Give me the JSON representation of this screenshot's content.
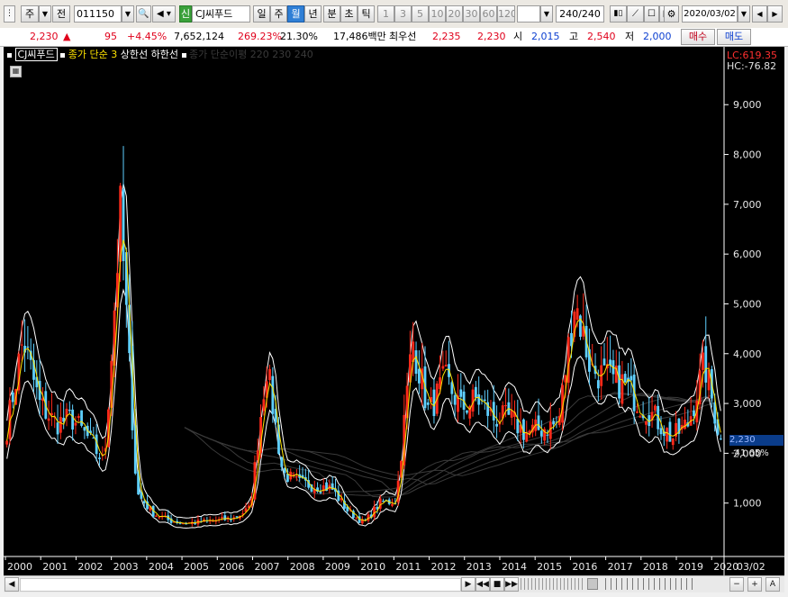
{
  "toolbar": {
    "period_type": "주",
    "market_toggle": "전",
    "stock_code": "011150",
    "stock_badge": "신",
    "stock_name": "CJ씨푸드",
    "timeframes": [
      "일",
      "주",
      "월",
      "년"
    ],
    "active_timeframe": "월",
    "intraday": [
      "분",
      "초",
      "틱"
    ],
    "intervals": [
      "1",
      "3",
      "5",
      "10",
      "20",
      "30",
      "60",
      "120"
    ],
    "count": "240/240",
    "date": "2020/03/02"
  },
  "quote": {
    "price": "2,230",
    "change_arrow": "▲",
    "change": "95",
    "change_pct": "+4.45%",
    "volume": "7,652,124",
    "volume_ratio": "269.23%",
    "turnover": "21.30%",
    "amount": "17,486백만",
    "best_ask_label": "최우선",
    "best_ask": "2,235",
    "best_bid": "2,230",
    "open_label": "시",
    "open": "2,015",
    "high_label": "고",
    "high": "2,540",
    "low_label": "저",
    "low": "2,000",
    "buy_button": "매수",
    "sell_button": "매도"
  },
  "chart_legend": {
    "name": "CJ씨푸드",
    "ma_label": "종가 단순 3",
    "upper_label": "상한선",
    "lower_label": "하한선",
    "extra_label": "종가 단순이평 220 230 240"
  },
  "chart_data": {
    "type": "candlestick",
    "title": "CJ씨푸드",
    "yticks": [
      "1,000",
      "2,000",
      "3,000",
      "4,000",
      "5,000",
      "6,000",
      "7,000",
      "8,000",
      "9,000"
    ],
    "ylim": [
      0,
      9800
    ],
    "xticks": [
      "2000",
      "2001",
      "2002",
      "2003",
      "2004",
      "2005",
      "2006",
      "2007",
      "2008",
      "2009",
      "2010",
      "2011",
      "2012",
      "2013",
      "2014",
      "2015",
      "2016",
      "2017",
      "2018",
      "2019",
      "2020",
      "03/02"
    ],
    "lc": "LC:619.35",
    "hc": "HC:-76.82",
    "current_price_tag": "2,230",
    "current_pct": "-41.65%",
    "closes": [
      2500,
      4300,
      3000,
      2600,
      2700,
      2300,
      1800,
      6800,
      1200,
      800,
      650,
      600,
      620,
      650,
      700,
      900,
      3800,
      1600,
      1400,
      1350,
      1300,
      850,
      600,
      1000,
      1050,
      4300,
      2800,
      3500,
      2900,
      3100,
      2700,
      2700,
      2400,
      2500,
      2600,
      5100,
      3700,
      3500,
      3400,
      3000,
      2700,
      2300,
      2600,
      3800,
      2230
    ],
    "colors": {
      "up": "#ff2a1a",
      "down": "#5fd0ff",
      "ma": "#ffe400",
      "band": "#ffffff"
    }
  },
  "scroll": {
    "buttons": [
      "◀",
      "▶",
      "◀◀",
      "■",
      "▶▶",
      "−",
      "+",
      "A"
    ]
  }
}
